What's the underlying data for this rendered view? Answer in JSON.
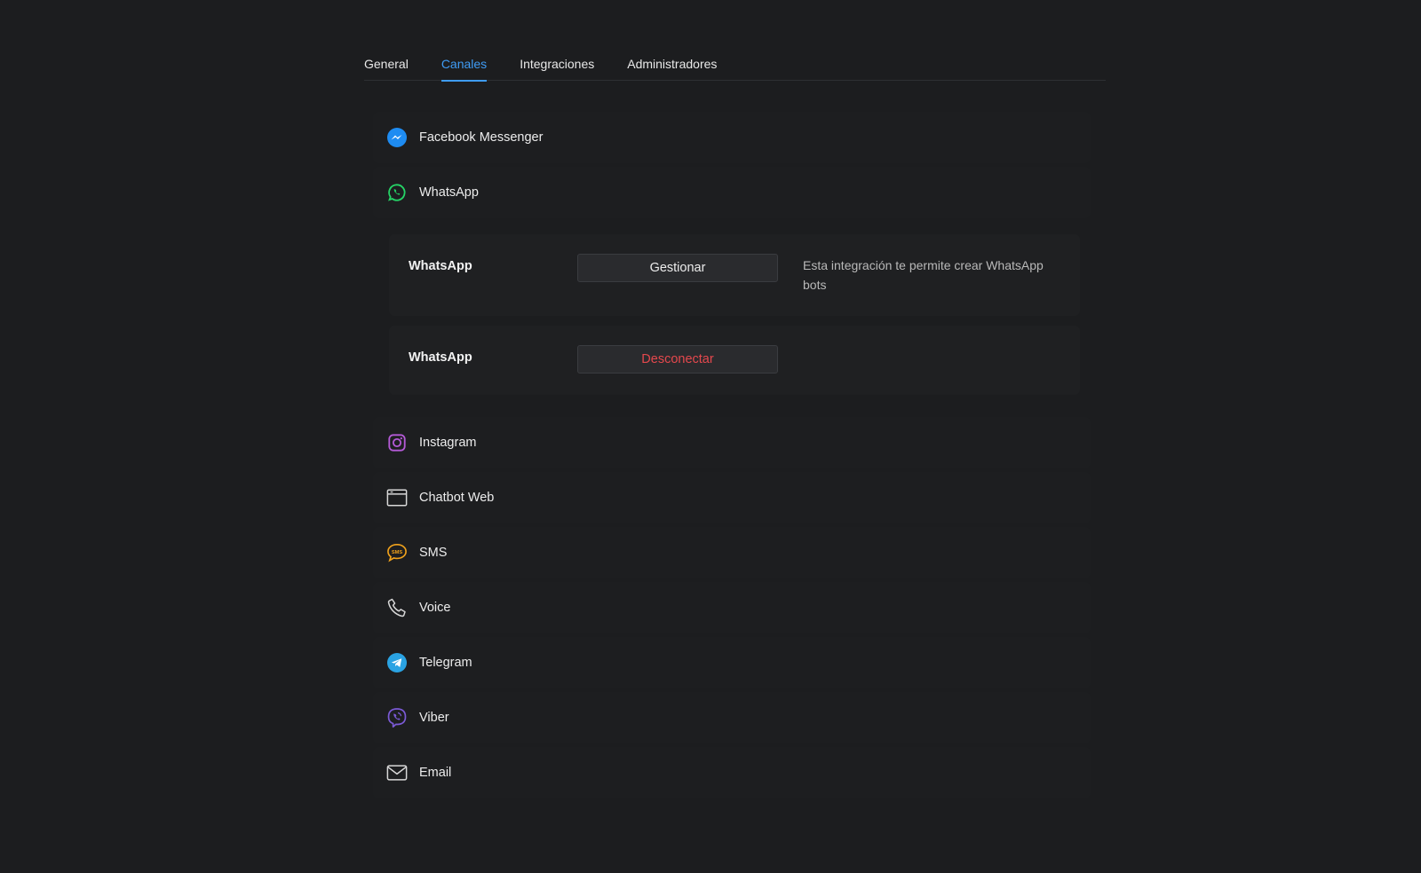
{
  "tabs": [
    {
      "label": "General"
    },
    {
      "label": "Canales"
    },
    {
      "label": "Integraciones"
    },
    {
      "label": "Administradores"
    }
  ],
  "active_tab": "Canales",
  "channels": [
    {
      "label": "Facebook Messenger",
      "icon": "messenger-icon",
      "color": "#1e8cf2"
    },
    {
      "label": "WhatsApp",
      "icon": "whatsapp-icon",
      "color": "#25d366"
    },
    {
      "label": "Instagram",
      "icon": "instagram-icon",
      "color": "#b45ad6"
    },
    {
      "label": "Chatbot Web",
      "icon": "browser-window-icon",
      "color": "#d8d8d8"
    },
    {
      "label": "SMS",
      "icon": "sms-icon",
      "color": "#f0a21c"
    },
    {
      "label": "Voice",
      "icon": "phone-icon",
      "color": "#d8d8d8"
    },
    {
      "label": "Telegram",
      "icon": "telegram-icon",
      "color": "#2aa3e3"
    },
    {
      "label": "Viber",
      "icon": "viber-icon",
      "color": "#7b5ad6"
    },
    {
      "label": "Email",
      "icon": "mail-icon",
      "color": "#d8d8d8"
    }
  ],
  "whatsapp_panel": {
    "rows": [
      {
        "name": "WhatsApp",
        "button": "Gestionar",
        "description": "Esta integración te permite crear WhatsApp bots"
      },
      {
        "name": "WhatsApp",
        "button": "Desconectar",
        "description": ""
      }
    ]
  },
  "colors": {
    "background": "#1c1d1f",
    "accent": "#3f9cf5",
    "danger": "#e5484d"
  }
}
